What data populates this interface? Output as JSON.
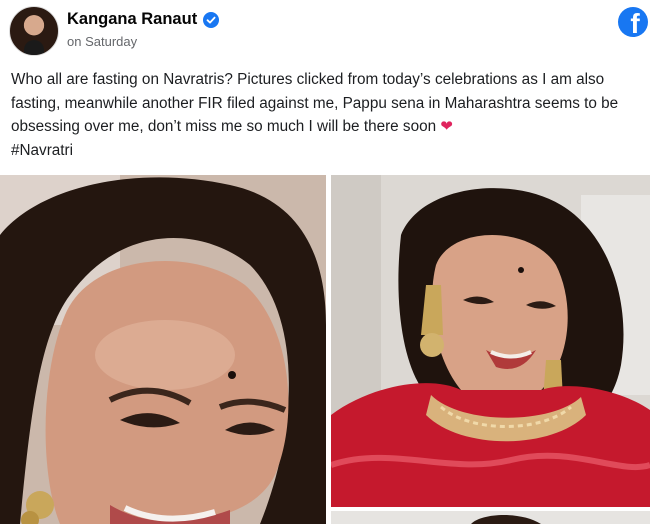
{
  "post": {
    "author": "Kangana Ranaut",
    "timestamp": "on Saturday",
    "text_part1": "Who all are fasting on Navratris? Pictures clicked from today’s celebrations as I am also fasting, meanwhile another FIR filed against me, Pappu sena in Maharashtra seems to be obsessing over me, don’t miss me so much I will be there soon ",
    "heart": "❤",
    "hashtag": "#Navratri",
    "verified": true
  },
  "brand": {
    "logo_letter": "f",
    "color": "#1877f2"
  },
  "icons": [
    "verified-badge-icon",
    "facebook-logo-icon",
    "heart-emoji-icon"
  ],
  "photos": [
    {
      "name": "selfie-closeup"
    },
    {
      "name": "red-saree-portrait"
    },
    {
      "name": "third-photo-partial"
    }
  ]
}
